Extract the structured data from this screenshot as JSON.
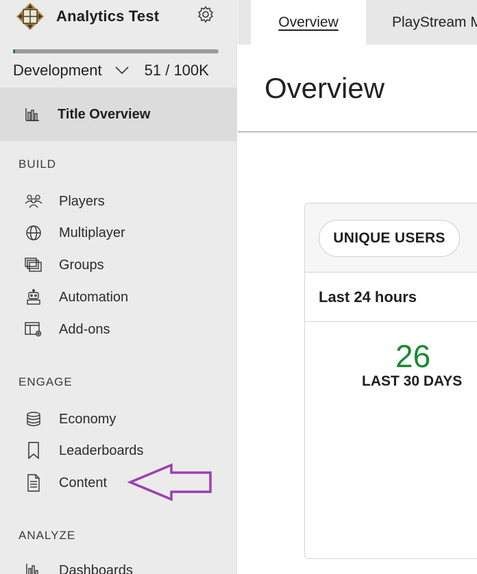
{
  "app": {
    "title": "Analytics Test"
  },
  "environment": {
    "name": "Development",
    "usage": "51 / 100K",
    "usage_fraction": 0.0005
  },
  "sidebar": {
    "overview": {
      "label": "Title Overview",
      "icon": "bar-chart-icon"
    },
    "sections": [
      {
        "title": "BUILD",
        "items": [
          {
            "label": "Players",
            "icon": "people-icon"
          },
          {
            "label": "Multiplayer",
            "icon": "globe-icon"
          },
          {
            "label": "Groups",
            "icon": "groups-icon"
          },
          {
            "label": "Automation",
            "icon": "robot-icon"
          },
          {
            "label": "Add-ons",
            "icon": "addons-icon"
          }
        ]
      },
      {
        "title": "ENGAGE",
        "items": [
          {
            "label": "Economy",
            "icon": "coins-icon"
          },
          {
            "label": "Leaderboards",
            "icon": "bookmark-icon"
          },
          {
            "label": "Content",
            "icon": "document-icon"
          }
        ]
      },
      {
        "title": "ANALYZE",
        "items": [
          {
            "label": "Dashboards",
            "icon": "dashboard-icon"
          }
        ]
      }
    ]
  },
  "tabs": [
    {
      "label": "Overview",
      "active": true
    },
    {
      "label": "PlayStream M",
      "active": false
    }
  ],
  "page": {
    "title": "Overview"
  },
  "card": {
    "metric_button": "UNIQUE USERS",
    "range": "Last 24 hours",
    "value": "26",
    "value_label": "LAST 30 DAYS",
    "value_color": "#1a8a2e"
  },
  "annotation": {
    "color": "#9b3fb0"
  }
}
